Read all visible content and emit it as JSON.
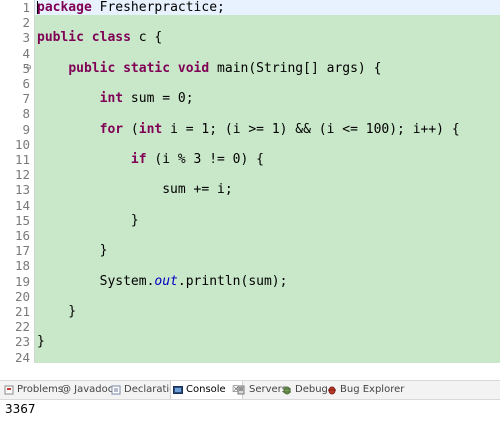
{
  "editor": {
    "lines": [
      {
        "n": "1",
        "fold": "",
        "tokens": [
          {
            "k": "kw",
            "t": "package"
          },
          {
            "k": "",
            "t": " Fresherpractice;"
          }
        ]
      },
      {
        "n": "2",
        "fold": "",
        "tokens": []
      },
      {
        "n": "3",
        "fold": "",
        "tokens": [
          {
            "k": "kw",
            "t": "public"
          },
          {
            "k": "",
            "t": " "
          },
          {
            "k": "kw",
            "t": "class"
          },
          {
            "k": "",
            "t": " c {"
          }
        ]
      },
      {
        "n": "4",
        "fold": "",
        "tokens": []
      },
      {
        "n": "5",
        "fold": "⊖",
        "tokens": [
          {
            "k": "",
            "t": "    "
          },
          {
            "k": "kw",
            "t": "public"
          },
          {
            "k": "",
            "t": " "
          },
          {
            "k": "kw",
            "t": "static"
          },
          {
            "k": "",
            "t": " "
          },
          {
            "k": "kw",
            "t": "void"
          },
          {
            "k": "",
            "t": " main(String[] args) {"
          }
        ]
      },
      {
        "n": "6",
        "fold": "",
        "tokens": []
      },
      {
        "n": "7",
        "fold": "",
        "tokens": [
          {
            "k": "",
            "t": "        "
          },
          {
            "k": "kw",
            "t": "int"
          },
          {
            "k": "",
            "t": " sum = 0;"
          }
        ]
      },
      {
        "n": "8",
        "fold": "",
        "tokens": []
      },
      {
        "n": "9",
        "fold": "",
        "tokens": [
          {
            "k": "",
            "t": "        "
          },
          {
            "k": "kw",
            "t": "for"
          },
          {
            "k": "",
            "t": " ("
          },
          {
            "k": "kw",
            "t": "int"
          },
          {
            "k": "",
            "t": " i = 1; (i >= 1) && (i <= 100); i++) {"
          }
        ]
      },
      {
        "n": "10",
        "fold": "",
        "tokens": []
      },
      {
        "n": "11",
        "fold": "",
        "tokens": [
          {
            "k": "",
            "t": "            "
          },
          {
            "k": "kw",
            "t": "if"
          },
          {
            "k": "",
            "t": " (i % 3 != 0) {"
          }
        ]
      },
      {
        "n": "12",
        "fold": "",
        "tokens": []
      },
      {
        "n": "13",
        "fold": "",
        "tokens": [
          {
            "k": "",
            "t": "                sum += i;"
          }
        ]
      },
      {
        "n": "14",
        "fold": "",
        "tokens": []
      },
      {
        "n": "15",
        "fold": "",
        "tokens": [
          {
            "k": "",
            "t": "            }"
          }
        ]
      },
      {
        "n": "16",
        "fold": "",
        "tokens": []
      },
      {
        "n": "17",
        "fold": "",
        "tokens": [
          {
            "k": "",
            "t": "        }"
          }
        ]
      },
      {
        "n": "18",
        "fold": "",
        "tokens": []
      },
      {
        "n": "19",
        "fold": "",
        "tokens": [
          {
            "k": "",
            "t": "        System."
          },
          {
            "k": "field",
            "t": "out"
          },
          {
            "k": "",
            "t": ".println(sum);"
          }
        ]
      },
      {
        "n": "20",
        "fold": "",
        "tokens": []
      },
      {
        "n": "21",
        "fold": "",
        "tokens": [
          {
            "k": "",
            "t": "    }"
          }
        ]
      },
      {
        "n": "22",
        "fold": "",
        "tokens": []
      },
      {
        "n": "23",
        "fold": "",
        "tokens": [
          {
            "k": "",
            "t": "}"
          }
        ]
      },
      {
        "n": "24",
        "fold": "",
        "tokens": []
      }
    ],
    "colors": {
      "keyword": "#7f0055",
      "field": "#0000c0",
      "background": "#c9e7c9",
      "line_numbers": "#7a7a7a"
    }
  },
  "panel": {
    "tabs": [
      {
        "label": "Problems",
        "icon": "problems-icon",
        "active": false
      },
      {
        "label": "@ Javadoc",
        "icon": "",
        "active": false
      },
      {
        "label": "Declaration",
        "icon": "declaration-icon",
        "active": false
      },
      {
        "label": "Console",
        "icon": "console-icon",
        "active": true,
        "close": "☒"
      },
      {
        "label": "Servers",
        "icon": "servers-icon",
        "active": false
      },
      {
        "label": "Debug",
        "icon": "debug-icon",
        "active": false
      },
      {
        "label": "Bug Explorer",
        "icon": "bug-explorer-icon",
        "active": false
      }
    ],
    "console_output": "3367"
  }
}
